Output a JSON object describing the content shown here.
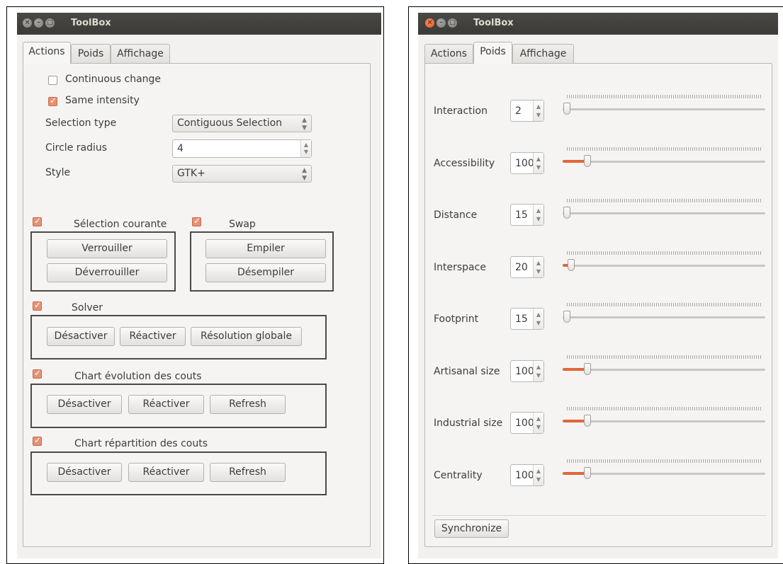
{
  "left_window": {
    "title": "ToolBox",
    "tabs": [
      "Actions",
      "Poids",
      "Affichage"
    ],
    "selected_tab": "Actions",
    "options": {
      "continuous_change": {
        "label": "Continuous change",
        "checked": false
      },
      "same_intensity": {
        "label": "Same intensity",
        "checked": true
      }
    },
    "fields": {
      "selection_type": {
        "label": "Selection type",
        "value": "Contiguous Selection"
      },
      "circle_radius": {
        "label": "Circle radius",
        "value": "4"
      },
      "style": {
        "label": "Style",
        "value": "GTK+"
      }
    },
    "groups": {
      "selection": {
        "label": "Sélection courante",
        "checked": true,
        "buttons": [
          "Verrouiller",
          "Déverrouiller"
        ]
      },
      "swap": {
        "label": "Swap",
        "checked": true,
        "buttons": [
          "Empiler",
          "Désempiler"
        ]
      },
      "solver": {
        "label": "Solver",
        "checked": true,
        "buttons": [
          "Désactiver",
          "Réactiver",
          "Résolution globale"
        ]
      },
      "chart_evolution": {
        "label": "Chart évolution des couts",
        "checked": true,
        "buttons": [
          "Désactiver",
          "Réactiver",
          "Refresh"
        ]
      },
      "chart_repartition": {
        "label": "Chart répartition des couts",
        "checked": true,
        "buttons": [
          "Désactiver",
          "Réactiver",
          "Refresh"
        ]
      }
    }
  },
  "right_window": {
    "title": "ToolBox",
    "tabs": [
      "Actions",
      "Poids",
      "Affichage"
    ],
    "selected_tab": "Poids",
    "weights": [
      {
        "label": "Interaction",
        "value": "2",
        "fraction": 0.0
      },
      {
        "label": "Accessibility",
        "value": "100",
        "fraction": 0.1
      },
      {
        "label": "Distance",
        "value": "15",
        "fraction": 0.0
      },
      {
        "label": "Interspace",
        "value": "20",
        "fraction": 0.02
      },
      {
        "label": "Footprint",
        "value": "15",
        "fraction": 0.0
      },
      {
        "label": "Artisanal size",
        "value": "100",
        "fraction": 0.1
      },
      {
        "label": "Industrial size",
        "value": "100",
        "fraction": 0.1
      },
      {
        "label": "Centrality",
        "value": "100",
        "fraction": 0.1
      }
    ],
    "synchronize_label": "Synchronize"
  },
  "colors": {
    "accent": "#e0663a",
    "titlebar": "#3b3a36",
    "window_bg": "#f2f1f0"
  }
}
